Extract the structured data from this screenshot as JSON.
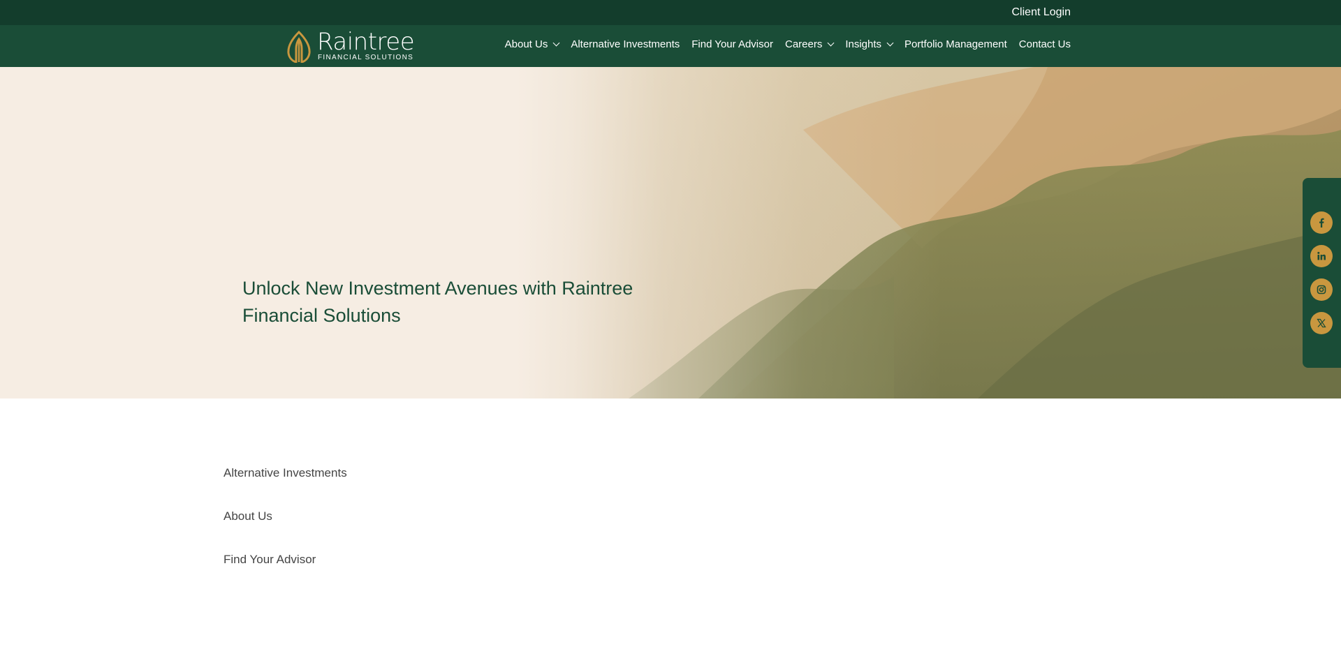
{
  "topbar": {
    "client_login": "Client Login"
  },
  "logo": {
    "name": "Raintree",
    "tagline": "FINANCIAL SOLUTIONS"
  },
  "nav": {
    "items": [
      {
        "label": "About Us",
        "has_dropdown": true
      },
      {
        "label": "Alternative Investments",
        "has_dropdown": false
      },
      {
        "label": "Find Your Advisor",
        "has_dropdown": false
      },
      {
        "label": "Careers",
        "has_dropdown": true
      },
      {
        "label": "Insights",
        "has_dropdown": true
      },
      {
        "label": "Portfolio Management",
        "has_dropdown": false
      },
      {
        "label": "Contact Us",
        "has_dropdown": false
      }
    ]
  },
  "hero": {
    "title": "Unlock New Investment Avenues with Raintree Financial Solutions"
  },
  "social": {
    "icons": [
      "facebook-icon",
      "linkedin-icon",
      "instagram-icon",
      "x-icon"
    ]
  },
  "links": [
    "Alternative Investments",
    "About Us",
    "Find Your Advisor"
  ],
  "colors": {
    "dark_green": "#133d2c",
    "green": "#1a4d37",
    "gold": "#c9973f",
    "cream": "#f6ece2",
    "link_text": "#444444"
  }
}
